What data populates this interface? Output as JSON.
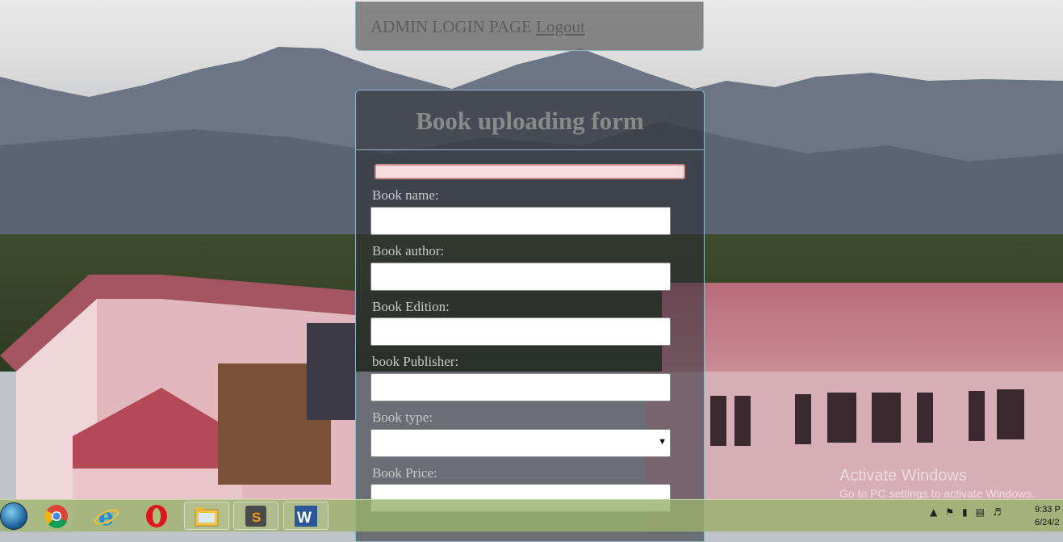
{
  "admin_bar": {
    "title": "ADMIN LOGIN PAGE",
    "logout_label": "Logout"
  },
  "form": {
    "title": "Book uploading form",
    "fields": [
      {
        "label": "Book name:",
        "value": ""
      },
      {
        "label": "Book author:",
        "value": ""
      },
      {
        "label": "Book Edition:",
        "value": ""
      },
      {
        "label": "book Publisher:",
        "value": ""
      },
      {
        "label": "Book type:",
        "value": ""
      },
      {
        "label": "Book Price:",
        "value": ""
      }
    ]
  },
  "watermark": {
    "line1": "Activate Windows",
    "line2": "Go to PC settings to activate Windows."
  },
  "taskbar": {
    "apps": [
      "chrome-icon",
      "internet-explorer-icon",
      "opera-icon",
      "file-explorer-icon",
      "sublime-text-icon",
      "word-icon"
    ],
    "clock_time": "9:33 P",
    "clock_date": "6/24/2"
  },
  "colors": {
    "panel_border": "#8fb7c6",
    "taskbar": "#98b26e",
    "error_box": "#f6dcdc"
  }
}
